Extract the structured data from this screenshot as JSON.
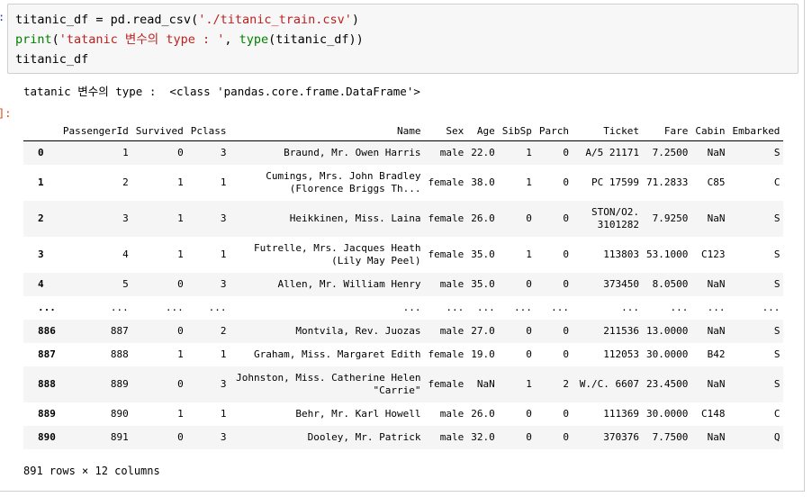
{
  "prompts": {
    "in": ":",
    "out": "]:"
  },
  "code": {
    "line1": {
      "a": "titanic_df = pd.read_csv(",
      "str": "'./titanic_train.csv'",
      "b": ")"
    },
    "line2": {
      "fn": "print",
      "p1": "(",
      "str": "'tatanic 변수의 type : '",
      "p2": ", ",
      "fn2": "type",
      "b": "(titanic_df))"
    },
    "line3": "titanic_df"
  },
  "stdout": "tatanic 변수의 type :  <class 'pandas.core.frame.DataFrame'>",
  "table": {
    "columns": [
      "",
      "PassengerId",
      "Survived",
      "Pclass",
      "Name",
      "Sex",
      "Age",
      "SibSp",
      "Parch",
      "Ticket",
      "Fare",
      "Cabin",
      "Embarked"
    ],
    "rows": [
      {
        "idx": "0",
        "cells": [
          "1",
          "0",
          "3",
          "Braund, Mr. Owen Harris",
          "male",
          "22.0",
          "1",
          "0",
          "A/5 21171",
          "7.2500",
          "NaN",
          "S"
        ]
      },
      {
        "idx": "1",
        "cells": [
          "2",
          "1",
          "1",
          "Cumings, Mrs. John Bradley (Florence Briggs Th...",
          "female",
          "38.0",
          "1",
          "0",
          "PC 17599",
          "71.2833",
          "C85",
          "C"
        ]
      },
      {
        "idx": "2",
        "cells": [
          "3",
          "1",
          "3",
          "Heikkinen, Miss. Laina",
          "female",
          "26.0",
          "0",
          "0",
          "STON/O2. 3101282",
          "7.9250",
          "NaN",
          "S"
        ]
      },
      {
        "idx": "3",
        "cells": [
          "4",
          "1",
          "1",
          "Futrelle, Mrs. Jacques Heath (Lily May Peel)",
          "female",
          "35.0",
          "1",
          "0",
          "113803",
          "53.1000",
          "C123",
          "S"
        ]
      },
      {
        "idx": "4",
        "cells": [
          "5",
          "0",
          "3",
          "Allen, Mr. William Henry",
          "male",
          "35.0",
          "0",
          "0",
          "373450",
          "8.0500",
          "NaN",
          "S"
        ]
      },
      {
        "idx": "...",
        "cells": [
          "...",
          "...",
          "...",
          "...",
          "...",
          "...",
          "...",
          "...",
          "...",
          "...",
          "...",
          "..."
        ]
      },
      {
        "idx": "886",
        "cells": [
          "887",
          "0",
          "2",
          "Montvila, Rev. Juozas",
          "male",
          "27.0",
          "0",
          "0",
          "211536",
          "13.0000",
          "NaN",
          "S"
        ]
      },
      {
        "idx": "887",
        "cells": [
          "888",
          "1",
          "1",
          "Graham, Miss. Margaret Edith",
          "female",
          "19.0",
          "0",
          "0",
          "112053",
          "30.0000",
          "B42",
          "S"
        ]
      },
      {
        "idx": "888",
        "cells": [
          "889",
          "0",
          "3",
          "Johnston, Miss. Catherine Helen \"Carrie\"",
          "female",
          "NaN",
          "1",
          "2",
          "W./C. 6607",
          "23.4500",
          "NaN",
          "S"
        ]
      },
      {
        "idx": "889",
        "cells": [
          "890",
          "1",
          "1",
          "Behr, Mr. Karl Howell",
          "male",
          "26.0",
          "0",
          "0",
          "111369",
          "30.0000",
          "C148",
          "C"
        ]
      },
      {
        "idx": "890",
        "cells": [
          "891",
          "0",
          "3",
          "Dooley, Mr. Patrick",
          "male",
          "32.0",
          "0",
          "0",
          "370376",
          "7.7500",
          "NaN",
          "Q"
        ]
      }
    ]
  },
  "footer": "891 rows × 12 columns"
}
